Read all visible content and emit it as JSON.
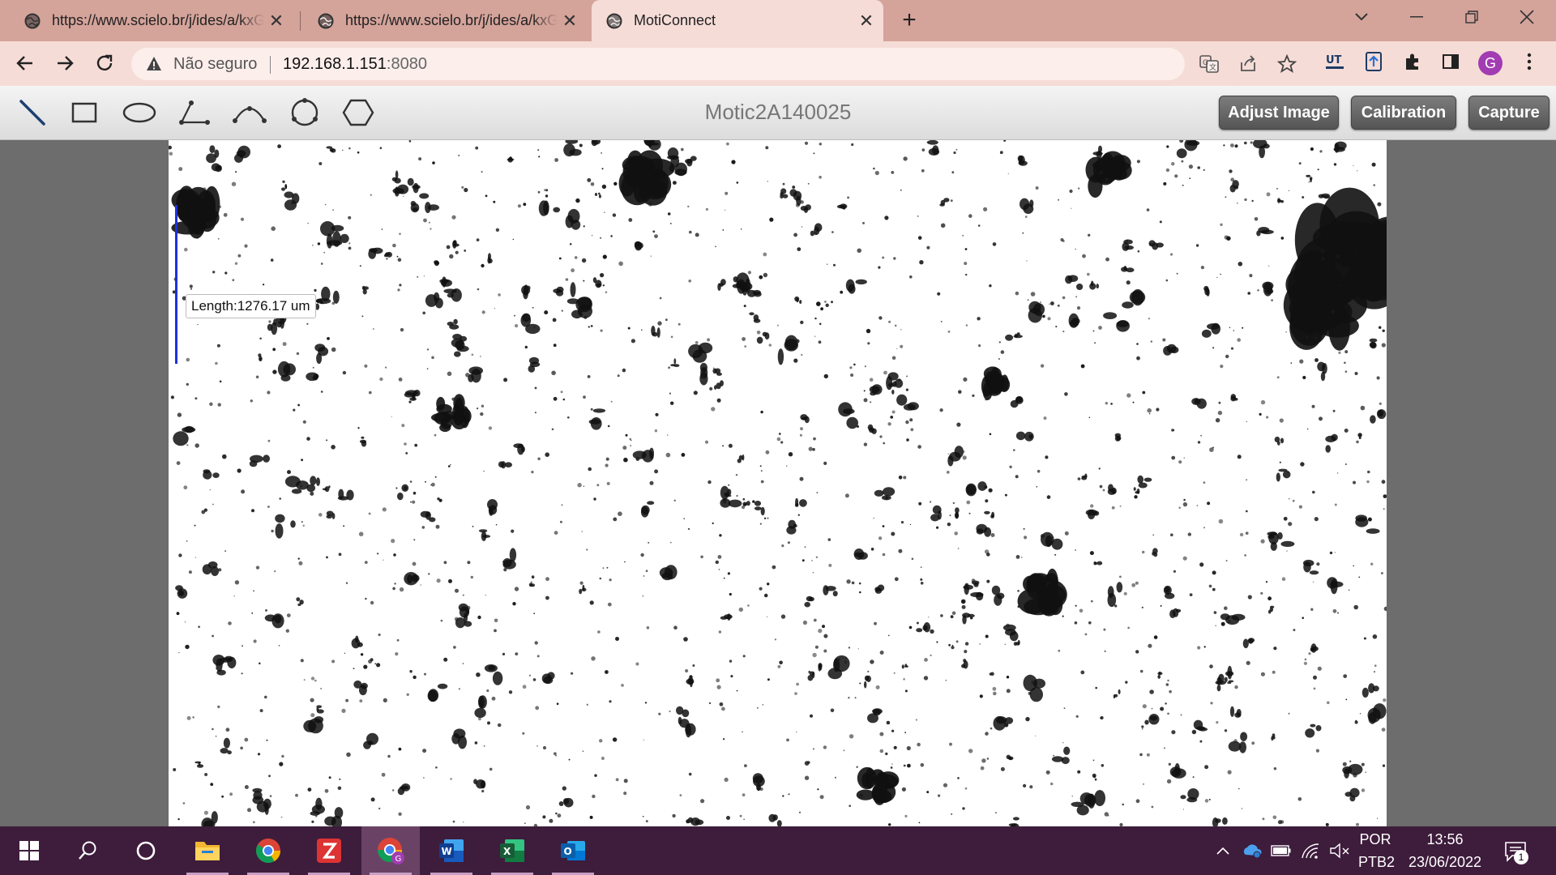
{
  "browser": {
    "tabs": [
      {
        "title": "https://www.scielo.br/j/ides/a/kxGm",
        "active": false
      },
      {
        "title": "https://www.scielo.br/j/ides/a/kxGm",
        "active": false
      },
      {
        "title": "MotiConnect",
        "active": true
      }
    ],
    "security_label": "Não seguro",
    "url_host": "192.168.1.151",
    "url_port": ":8080",
    "profile_initial": "G"
  },
  "app": {
    "device_name": "Motic2A140025",
    "buttons": {
      "adjust": "Adjust Image",
      "calibration": "Calibration",
      "capture": "Capture"
    },
    "tools": [
      "line-tool",
      "rectangle-tool",
      "ellipse-tool",
      "angle-tool",
      "arc-tool",
      "circle-tool",
      "polygon-tool"
    ],
    "measurement": {
      "label": "Length:1276.17 um",
      "color": "#1f2fe0"
    }
  },
  "taskbar": {
    "lang_primary": "POR",
    "lang_secondary": "PTB2",
    "time": "13:56",
    "date": "23/06/2022",
    "notification_count": "1",
    "apps": [
      "file-explorer",
      "chrome",
      "zotero",
      "chrome-profile",
      "word",
      "excel",
      "outlook"
    ]
  },
  "colors": {
    "tab_strip": "#d4a39a",
    "toolbar": "#f6dcd7",
    "taskbar": "#3e1c3c"
  }
}
